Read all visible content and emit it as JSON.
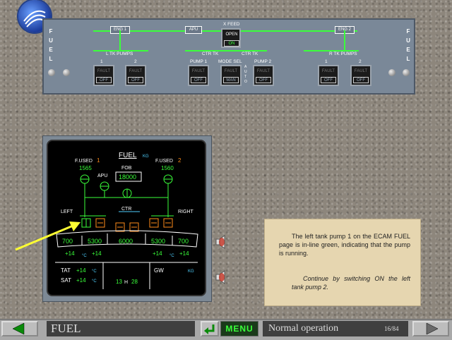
{
  "overhead": {
    "side_letters": [
      "F",
      "U",
      "E",
      "L"
    ],
    "eng1": "ENG 1",
    "apu": "APU",
    "xfeed": "X FEED",
    "xfeed_top": "OPEN",
    "xfeed_bot": "ON",
    "eng2": "ENG 2",
    "l_tk_pumps": "L TK PUMPS",
    "ctr_tk_left": "CTR TK",
    "ctr_tk_right": "CTR TK",
    "r_tk_pumps": "R TK PUMPS",
    "pump1": "PUMP 1",
    "mode_sel": "MODE SEL",
    "pump2": "PUMP 2",
    "num1": "1",
    "num2": "2",
    "auto": "A U T O",
    "buttons": [
      {
        "top": "FAULT",
        "bot": "OFF"
      },
      {
        "top": "FAULT",
        "bot": "OFF"
      },
      {
        "top": "FAULT",
        "bot": "OFF"
      },
      {
        "top": "FAULT",
        "bot": "MAN"
      },
      {
        "top": "FAULT",
        "bot": "OFF"
      },
      {
        "top": "FAULT",
        "bot": "OFF"
      },
      {
        "top": "FAULT",
        "bot": "OFF"
      }
    ]
  },
  "ecam": {
    "title": "FUEL",
    "title_unit": "KG",
    "fused1_label": "F.USED",
    "fused1_num": "1",
    "fused1_value": "1565",
    "fused2_label": "F.USED",
    "fused2_num": "2",
    "fused2_value": "1560",
    "fob_label": "FOB",
    "fob_value": "18000",
    "apu_label": "APU",
    "left_label": "LEFT",
    "ctr_label": "CTR",
    "right_label": "RIGHT",
    "qty": [
      "700",
      "5300",
      "6000",
      "5300",
      "700"
    ],
    "temps_left": [
      "+14",
      "°C",
      "+14"
    ],
    "temps_right": [
      "+14",
      "°C",
      "+14"
    ],
    "tat_label": "TAT",
    "tat_value": "+14",
    "tat_unit": "°C",
    "sat_label": "SAT",
    "sat_value": "+14",
    "sat_unit": "°C",
    "time_h": "13",
    "time_sep": "H",
    "time_m": "28",
    "gw_label": "GW",
    "gw_unit": "KG"
  },
  "info": {
    "para1": "The left tank pump 1 on the ECAM FUEL page is in-line green, indicating that the pump is running.",
    "para2": "Continue by switching ON the left tank pump 2."
  },
  "footer": {
    "module": "FUEL",
    "menu": "MENU",
    "section": "Normal operation",
    "page": "16/84"
  },
  "colors": {
    "ecam_green": "#3aff3a",
    "ecam_amber": "#ff8c1a",
    "ecam_cyan": "#4fd0ff",
    "arrow_yellow": "#ffff33"
  }
}
